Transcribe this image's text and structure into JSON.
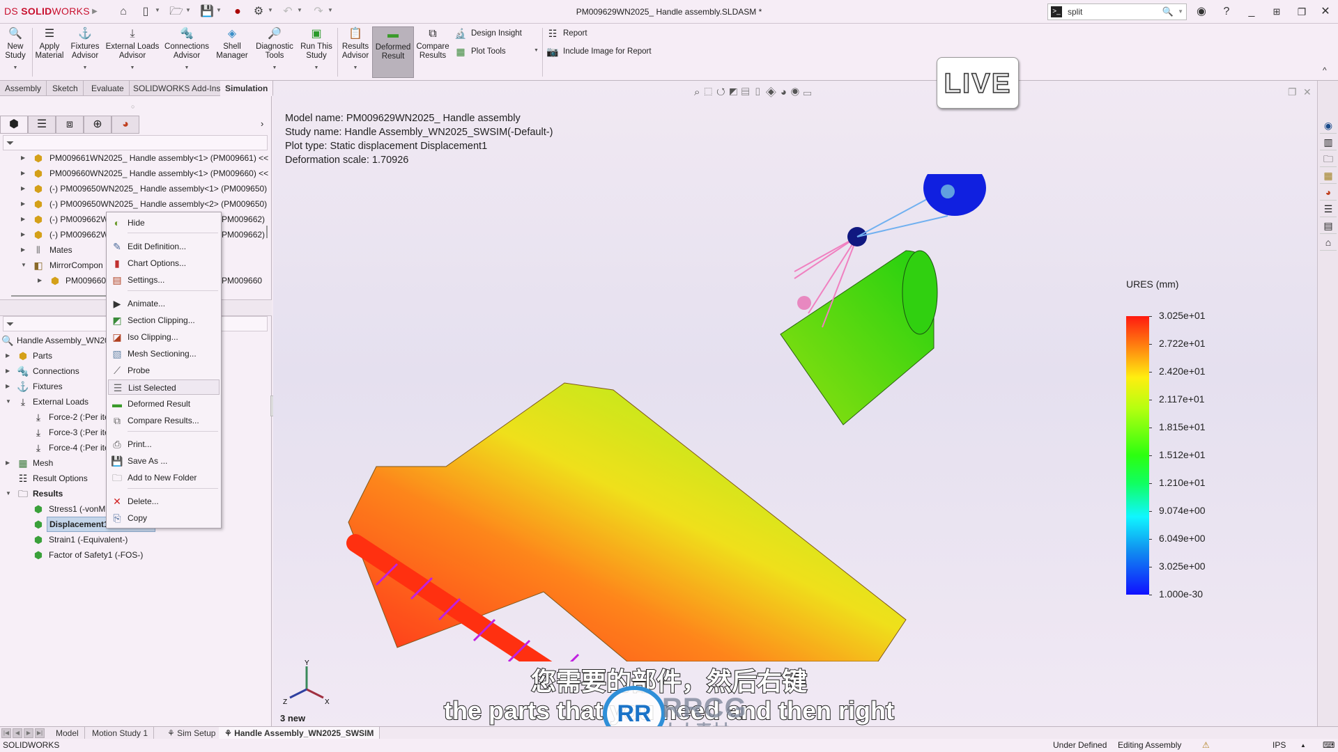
{
  "app": {
    "logo_ds": "DS",
    "logo_solid": "SOLID",
    "logo_works": "WORKS",
    "document_title": "PM009629WN2025_ Handle assembly.SLDASM *",
    "search_value": "split",
    "search_cmd_glyph": ">_"
  },
  "ribbon": {
    "buttons": [
      {
        "label1": "New",
        "label2": "Study",
        "icon": "new-study-icon"
      },
      {
        "label1": "Apply",
        "label2": "Material",
        "icon": "apply-material-icon"
      },
      {
        "label1": "Fixtures",
        "label2": "Advisor",
        "icon": "fixtures-advisor-icon"
      },
      {
        "label1": "External Loads",
        "label2": "Advisor",
        "icon": "external-loads-icon"
      },
      {
        "label1": "Connections",
        "label2": "Advisor",
        "icon": "connections-advisor-icon"
      },
      {
        "label1": "Shell",
        "label2": "Manager",
        "icon": "shell-manager-icon"
      },
      {
        "label1": "Diagnostic",
        "label2": "Tools",
        "icon": "diagnostic-tools-icon"
      },
      {
        "label1": "Run This",
        "label2": "Study",
        "icon": "run-study-icon"
      },
      {
        "label1": "Results",
        "label2": "Advisor",
        "icon": "results-advisor-icon"
      },
      {
        "label1": "Deformed",
        "label2": "Result",
        "icon": "deformed-result-icon"
      },
      {
        "label1": "Compare",
        "label2": "Results",
        "icon": "compare-results-icon"
      }
    ],
    "small": {
      "design_insight": "Design Insight",
      "plot_tools": "Plot Tools",
      "report": "Report",
      "include_image": "Include Image for Report"
    }
  },
  "command_tabs": [
    "Assembly",
    "Sketch",
    "Evaluate",
    "SOLIDWORKS Add-Ins",
    "Simulation"
  ],
  "command_tabs_selected": "Simulation",
  "feature_tree": {
    "items": [
      {
        "label": "PM009661WN2025_ Handle assembly<1> (PM009661) <<"
      },
      {
        "label": "PM009660WN2025_ Handle assembly<1> (PM009660) <<"
      },
      {
        "label": "(-) PM009650WN2025_ Handle assembly<1> (PM009650)"
      },
      {
        "label": "(-) PM009650WN2025_ Handle assembly<2> (PM009650)"
      },
      {
        "label": "(-) PM009662W",
        "tail": "PM009662)"
      },
      {
        "label": "(-) PM009662W",
        "tail": "PM009662)"
      },
      {
        "label": "Mates"
      },
      {
        "label": "MirrorCompon"
      },
      {
        "label": "PM009660V",
        "tail": "PM009660"
      }
    ]
  },
  "sim_tree": {
    "root": "Handle Assembly_WN20",
    "items": [
      {
        "label": "Parts"
      },
      {
        "label": "Connections"
      },
      {
        "label": "Fixtures"
      },
      {
        "label": "External Loads"
      },
      {
        "label": "Force-2 (:Per ite"
      },
      {
        "label": "Force-3 (:Per ite"
      },
      {
        "label": "Force-4 (:Per ite"
      },
      {
        "label": "Mesh"
      },
      {
        "label": "Result Options"
      },
      {
        "label": "Results"
      },
      {
        "label": "Stress1 (-vonMi"
      },
      {
        "label": "Displacement1"
      },
      {
        "label": "Strain1 (-Equivalent-)"
      },
      {
        "label": "Factor of Safety1 (-FOS-)"
      }
    ]
  },
  "context_menu": {
    "items": [
      {
        "label": "Hide"
      },
      {
        "label": "Edit Definition..."
      },
      {
        "label": "Chart Options..."
      },
      {
        "label": "Settings..."
      },
      {
        "label": "Animate..."
      },
      {
        "label": "Section Clipping..."
      },
      {
        "label": "Iso Clipping..."
      },
      {
        "label": "Mesh Sectioning..."
      },
      {
        "label": "Probe"
      },
      {
        "label": "List Selected"
      },
      {
        "label": "Deformed Result"
      },
      {
        "label": "Compare Results..."
      },
      {
        "label": "Print..."
      },
      {
        "label": "Save As ..."
      },
      {
        "label": "Add to New Folder"
      },
      {
        "label": "Delete..."
      },
      {
        "label": "Copy"
      }
    ],
    "highlighted": "List Selected"
  },
  "viewport": {
    "info": {
      "model_name": "Model name: PM009629WN2025_ Handle assembly",
      "study_name": "Study name: Handle Assembly_WN2025_SWSIM(-Default-)",
      "plot_type": "Plot type: Static displacement Displacement1",
      "deformation_scale": "Deformation scale: 1.70926"
    },
    "live_badge": "LIVE",
    "triad_label": "3 new",
    "triad_axes": {
      "x": "X",
      "y": "Y",
      "z": "Z"
    }
  },
  "legend": {
    "title": "URES (mm)",
    "ticks": [
      "3.025e+01",
      "2.722e+01",
      "2.420e+01",
      "2.117e+01",
      "1.815e+01",
      "1.512e+01",
      "1.210e+01",
      "9.074e+00",
      "6.049e+00",
      "3.025e+00",
      "1.000e-30"
    ],
    "max": 30.25,
    "min": 1e-30,
    "colors": {
      "max": "#ff1a10",
      "mid": "#2cff10",
      "min": "#1010ff"
    }
  },
  "subtitles": {
    "chinese": "您需要的部件，然后右键",
    "english": "the parts that you need and then right"
  },
  "watermark": {
    "logo": "RR",
    "text": "RRCG",
    "cn": "人人素材"
  },
  "model_tabs": [
    "Model",
    "Motion Study 1",
    "Sim Setup",
    "Handle Assembly_WN2025_SWSIM"
  ],
  "model_tabs_selected": "Handle Assembly_WN2025_SWSIM",
  "status_bar": {
    "app": "SOLIDWORKS",
    "state": "Under Defined",
    "mode": "Editing Assembly",
    "units": "IPS"
  }
}
